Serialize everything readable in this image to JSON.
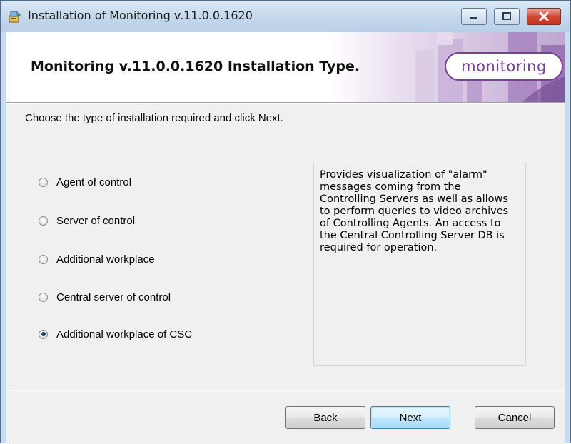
{
  "window": {
    "title": "Installation of Monitoring v.11.0.0.1620"
  },
  "icons": {
    "app": "installer-icon",
    "minimize": "minimize-icon",
    "maximize": "maximize-icon",
    "close": "close-icon"
  },
  "banner": {
    "heading": "Monitoring v.11.0.0.1620 Installation Type.",
    "logo_text": "monitoring"
  },
  "instruction": "Choose the type of installation required and click Next.",
  "options": [
    {
      "label": "Agent of control",
      "selected": false
    },
    {
      "label": "Server of control",
      "selected": false
    },
    {
      "label": "Additional workplace",
      "selected": false
    },
    {
      "label": "Central server of control",
      "selected": false
    },
    {
      "label": "Additional workplace of CSC",
      "selected": true
    }
  ],
  "description": "Provides visualization of \"alarm\" messages coming from the Controlling Servers as well as allows to perform queries to video archives of Controlling Agents. An access to the Central Controlling Server DB is required for operation.",
  "buttons": {
    "back": "Back",
    "next": "Next",
    "cancel": "Cancel"
  },
  "colors": {
    "brand_purple": "#7b3f95",
    "default_button_border": "#3c7fb1",
    "close_button_red": "#c2341f"
  }
}
